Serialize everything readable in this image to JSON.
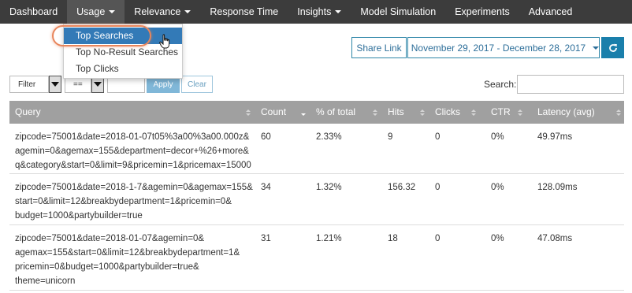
{
  "nav": {
    "items": [
      {
        "label": "Dashboard",
        "has_caret": false
      },
      {
        "label": "Usage",
        "has_caret": true,
        "active": true
      },
      {
        "label": "Relevance",
        "has_caret": true
      },
      {
        "label": "Response Time",
        "has_caret": false
      },
      {
        "label": "Insights",
        "has_caret": true
      },
      {
        "label": "Model Simulation",
        "has_caret": false
      },
      {
        "label": "Experiments",
        "has_caret": false
      },
      {
        "label": "Advanced",
        "has_caret": false
      }
    ]
  },
  "usage_menu": {
    "items": [
      "Top Searches",
      "Top No-Result Searches",
      "Top Clicks"
    ],
    "selected": "Top Searches"
  },
  "toolbar": {
    "share_label": "Share Link",
    "date_range": "November 29, 2017 - December 28, 2017",
    "calendar_icon": "calendar-icon",
    "refresh_icon": "refresh-icon"
  },
  "filter": {
    "field_value": "Filter",
    "operator_value": "==",
    "value_input": "",
    "apply_label": "Apply",
    "clear_label": "Clear",
    "search_label": "Search:",
    "search_value": ""
  },
  "table": {
    "columns": [
      "Query",
      "Count",
      "% of total",
      "Hits",
      "Clicks",
      "CTR",
      "Latency (avg)"
    ],
    "sorted_column": "Count",
    "sort_direction": "desc",
    "rows": [
      {
        "query_lines": [
          "zipcode=75001&date=2018-01-07t05%3a00%3a00.000z&",
          "agemin=0&agemax=155&department=decor+%26+more&",
          "q&category&start=0&limit=9&pricemin=1&pricemax=15000"
        ],
        "count": "60",
        "pct": "2.33%",
        "hits": "9",
        "clicks": "0",
        "ctr": "0%",
        "latency": "49.97ms"
      },
      {
        "query_lines": [
          "zipcode=75001&date=2018-1-7&agemin=0&agemax=155&",
          "start=0&limit=12&breakbydepartment=1&pricemin=0&",
          "budget=1000&partybuilder=true"
        ],
        "count": "34",
        "pct": "1.32%",
        "hits": "156.32",
        "clicks": "0",
        "ctr": "0%",
        "latency": "128.09ms"
      },
      {
        "query_lines": [
          "zipcode=75001&date=2018-01-07&agemin=0&",
          "agemax=155&start=0&limit=12&breakbydepartment=1&",
          "pricemin=0&budget=1000&partybuilder=true&",
          "theme=unicorn"
        ],
        "count": "31",
        "pct": "1.21%",
        "hits": "18",
        "clicks": "0",
        "ctr": "0%",
        "latency": "47.08ms"
      }
    ]
  }
}
